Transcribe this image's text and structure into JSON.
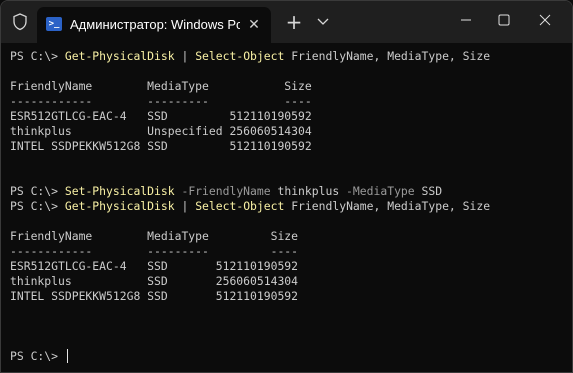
{
  "colors": {
    "background": "#0c0c0c",
    "titlebar": "#1f1f1f",
    "text": "#cccccc",
    "command": "#f9f1a5",
    "parameter": "#9a9a9a",
    "tab_icon": "#2b62c7"
  },
  "titlebar": {
    "shield_icon": "shield-icon",
    "tab": {
      "icon": "powershell-icon",
      "icon_glyph": ">_",
      "title": "Администратор: Windows Pc",
      "close_glyph": "✕"
    },
    "new_tab_glyph": "+",
    "dropdown_icon": "chevron-down-icon",
    "window_buttons": [
      "minimize-icon",
      "maximize-icon",
      "close-icon"
    ]
  },
  "terminal": {
    "block1": {
      "prompt": "PS C:\\> ",
      "cmd1": "Get-PhysicalDisk",
      "pipe": " | ",
      "cmd2": "Select-Object",
      "args": " FriendlyName, MediaType, Size",
      "header": "FriendlyName        MediaType           Size",
      "separator": "------------        ---------           ----",
      "rows": [
        "ESR512GTLCG-EAC-4   SSD         512110190592",
        "thinkplus           Unspecified 256060514304",
        "INTEL SSDPEKKW512G8 SSD         512110190592"
      ]
    },
    "set_command": {
      "prompt": "PS C:\\> ",
      "cmd": "Set-PhysicalDisk",
      "param1": " -FriendlyName",
      "value1": " thinkplus",
      "param2": " -MediaType",
      "value2": " SSD"
    },
    "block2": {
      "prompt": "PS C:\\> ",
      "cmd1": "Get-PhysicalDisk",
      "pipe": " | ",
      "cmd2": "Select-Object",
      "args": " FriendlyName, MediaType, Size",
      "header": "FriendlyName        MediaType         Size",
      "separator": "------------        ---------         ----",
      "rows": [
        "ESR512GTLCG-EAC-4   SSD       512110190592",
        "thinkplus           SSD       256060514304",
        "INTEL SSDPEKKW512G8 SSD       512110190592"
      ]
    },
    "final_prompt": "PS C:\\> "
  }
}
